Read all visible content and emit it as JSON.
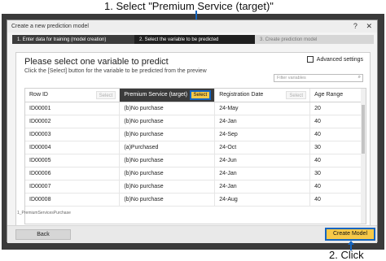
{
  "annotations": {
    "top": "1. Select \"Premium Service (target)\"",
    "bottom": "2. Click",
    "accent_color": "#1565c0"
  },
  "modal": {
    "title": "Create a new prediction model",
    "help_icon": "?",
    "close_icon": "✕"
  },
  "steps": [
    {
      "label": "1. Enter data for training (model creation)"
    },
    {
      "label": "2. Select the variable to be predicted"
    },
    {
      "label": "3. Create prediction model"
    }
  ],
  "panel": {
    "title": "Please select one variable to predict",
    "subtitle": "Click the [Select] button for the variable to be predicted from the preview",
    "advanced_label": "Advanced settings",
    "filter_placeholder": "Filter variables"
  },
  "table": {
    "select_label": "Select",
    "columns": [
      {
        "label": "Row ID",
        "has_select": true
      },
      {
        "label": "Premium Service (target)",
        "has_select": true
      },
      {
        "label": "Registration Date",
        "has_select": true
      },
      {
        "label": "Age Range",
        "has_select": false
      }
    ],
    "rows": [
      [
        "ID00001",
        "(b)No purchase",
        "24-May",
        "20"
      ],
      [
        "ID00002",
        "(b)No purchase",
        "24-Jan",
        "40"
      ],
      [
        "ID00003",
        "(b)No purchase",
        "24-Sep",
        "40"
      ],
      [
        "ID00004",
        "(a)Purchased",
        "24-Oct",
        "30"
      ],
      [
        "ID00005",
        "(b)No purchase",
        "24-Jun",
        "40"
      ],
      [
        "ID00006",
        "(b)No purchase",
        "24-Jan",
        "30"
      ],
      [
        "ID00007",
        "(b)No purchase",
        "24-Jan",
        "40"
      ],
      [
        "ID00008",
        "(b)No purchase",
        "24-Aug",
        "40"
      ]
    ]
  },
  "note": "1_PremiumServicesPurchase",
  "footer": {
    "back_label": "Back",
    "create_label": "Create Model"
  }
}
